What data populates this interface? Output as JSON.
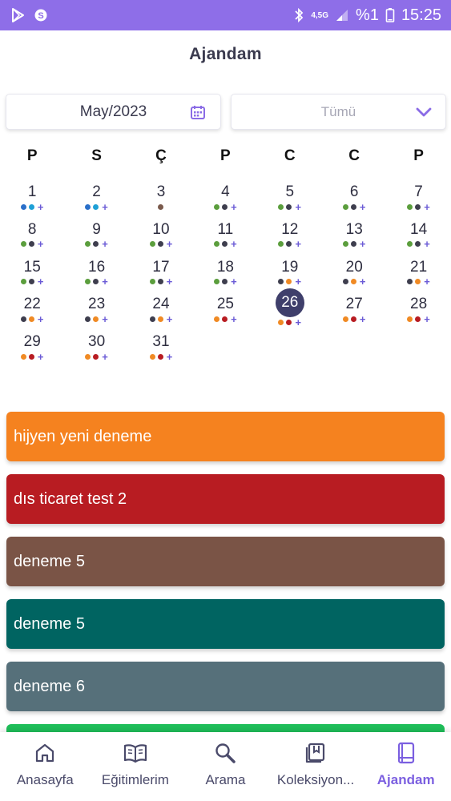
{
  "status_bar": {
    "network": "4,5G",
    "battery": "%1",
    "time": "15:25"
  },
  "header": {
    "title": "Ajandam"
  },
  "filters": {
    "month_value": "May/2023",
    "type_value": "Tümü"
  },
  "calendar": {
    "weekdays": [
      "P",
      "S",
      "Ç",
      "P",
      "C",
      "C",
      "P"
    ],
    "selected_day": "26",
    "colors": {
      "green": "#5b9e3d",
      "dark": "#3e3e4e",
      "blue": "#2a6fc9",
      "cyan": "#1ea0d6",
      "brown": "#7a5a4c",
      "orange": "#f08a24",
      "red": "#b81c22",
      "selected": "#3f3f6b"
    },
    "days": [
      {
        "num": "1",
        "dots": [
          "blue",
          "cyan"
        ],
        "plus": true
      },
      {
        "num": "2",
        "dots": [
          "blue",
          "cyan"
        ],
        "plus": true
      },
      {
        "num": "3",
        "dots": [
          "brown"
        ],
        "plus": false
      },
      {
        "num": "4",
        "dots": [
          "green",
          "dark"
        ],
        "plus": true
      },
      {
        "num": "5",
        "dots": [
          "green",
          "dark"
        ],
        "plus": true
      },
      {
        "num": "6",
        "dots": [
          "green",
          "dark"
        ],
        "plus": true
      },
      {
        "num": "7",
        "dots": [
          "green",
          "dark"
        ],
        "plus": true
      },
      {
        "num": "8",
        "dots": [
          "green",
          "dark"
        ],
        "plus": true
      },
      {
        "num": "9",
        "dots": [
          "green",
          "dark"
        ],
        "plus": true
      },
      {
        "num": "10",
        "dots": [
          "green",
          "dark"
        ],
        "plus": true
      },
      {
        "num": "11",
        "dots": [
          "green",
          "dark"
        ],
        "plus": true
      },
      {
        "num": "12",
        "dots": [
          "green",
          "dark"
        ],
        "plus": true
      },
      {
        "num": "13",
        "dots": [
          "green",
          "dark"
        ],
        "plus": true
      },
      {
        "num": "14",
        "dots": [
          "green",
          "dark"
        ],
        "plus": true
      },
      {
        "num": "15",
        "dots": [
          "green",
          "dark"
        ],
        "plus": true
      },
      {
        "num": "16",
        "dots": [
          "green",
          "dark"
        ],
        "plus": true
      },
      {
        "num": "17",
        "dots": [
          "green",
          "dark"
        ],
        "plus": true
      },
      {
        "num": "18",
        "dots": [
          "green",
          "dark"
        ],
        "plus": true
      },
      {
        "num": "19",
        "dots": [
          "dark",
          "orange"
        ],
        "plus": true
      },
      {
        "num": "20",
        "dots": [
          "dark",
          "orange"
        ],
        "plus": true
      },
      {
        "num": "21",
        "dots": [
          "dark",
          "orange"
        ],
        "plus": true
      },
      {
        "num": "22",
        "dots": [
          "dark",
          "orange"
        ],
        "plus": true
      },
      {
        "num": "23",
        "dots": [
          "dark",
          "orange"
        ],
        "plus": true
      },
      {
        "num": "24",
        "dots": [
          "dark",
          "orange"
        ],
        "plus": true
      },
      {
        "num": "25",
        "dots": [
          "orange",
          "red"
        ],
        "plus": true
      },
      {
        "num": "26",
        "dots": [
          "orange",
          "red"
        ],
        "plus": true
      },
      {
        "num": "27",
        "dots": [
          "orange",
          "red"
        ],
        "plus": true
      },
      {
        "num": "28",
        "dots": [
          "orange",
          "red"
        ],
        "plus": true
      },
      {
        "num": "29",
        "dots": [
          "orange",
          "red"
        ],
        "plus": true
      },
      {
        "num": "30",
        "dots": [
          "orange",
          "red"
        ],
        "plus": true
      },
      {
        "num": "31",
        "dots": [
          "orange",
          "red"
        ],
        "plus": true
      }
    ]
  },
  "events": [
    {
      "title": "hijyen yeni deneme",
      "color": "#f5821f"
    },
    {
      "title": "dıs ticaret test 2",
      "color": "#b81c22"
    },
    {
      "title": "deneme 5",
      "color": "#7a5446"
    },
    {
      "title": "deneme 5",
      "color": "#006461"
    },
    {
      "title": "deneme 6",
      "color": "#56707a"
    }
  ],
  "events_peek_color": "#1fbf5a",
  "bottom_nav": {
    "items": [
      {
        "label": "Anasayfa",
        "icon": "home-icon",
        "active": false
      },
      {
        "label": "Eğitimlerim",
        "icon": "book-open-icon",
        "active": false
      },
      {
        "label": "Arama",
        "icon": "search-icon",
        "active": false
      },
      {
        "label": "Koleksiyon...",
        "icon": "collection-icon",
        "active": false
      },
      {
        "label": "Ajandam",
        "icon": "agenda-icon",
        "active": true
      }
    ],
    "active_color": "#7b5fe0"
  }
}
